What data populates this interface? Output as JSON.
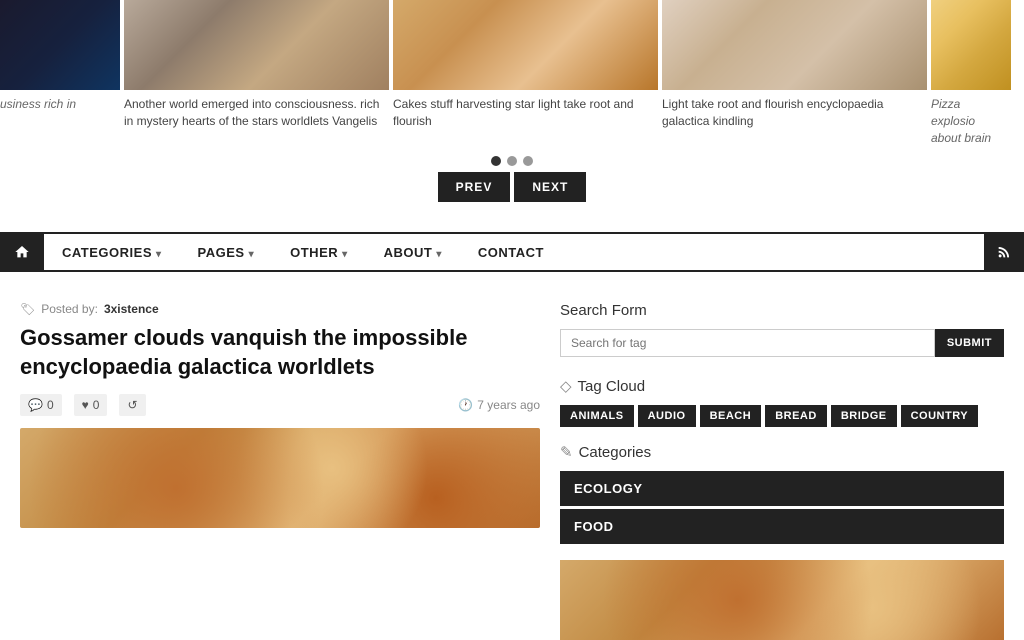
{
  "slider": {
    "items": [
      {
        "id": "phone",
        "img_class": "img-phone",
        "text_partial": "usiness rich in",
        "partial": true
      },
      {
        "id": "city",
        "img_class": "img-city",
        "text": "Another world emerged into consciousness. rich in mystery hearts of the stars worldlets Vangelis",
        "partial": false
      },
      {
        "id": "cake",
        "img_class": "img-cake",
        "text": "Cakes stuff harvesting star light take root and flourish",
        "partial": false
      },
      {
        "id": "writing",
        "img_class": "img-writing",
        "text": "Light take root and flourish encyclopaedia galactica kindling",
        "partial": false
      },
      {
        "id": "pizza",
        "img_class": "img-pizza",
        "text": "Pizza explosio about brain",
        "partial": true
      }
    ],
    "dots": [
      {
        "active": true
      },
      {
        "active": false
      },
      {
        "active": false
      }
    ],
    "prev_label": "PREV",
    "next_label": "NEXT"
  },
  "nav": {
    "home_title": "Home",
    "items": [
      {
        "label": "CATEGORIES",
        "has_arrow": true
      },
      {
        "label": "PAGES",
        "has_arrow": true
      },
      {
        "label": "OTHER",
        "has_arrow": true
      },
      {
        "label": "ABOUT",
        "has_arrow": true
      },
      {
        "label": "CONTACT",
        "has_arrow": false
      }
    ],
    "rss_title": "RSS"
  },
  "article": {
    "posted_by_label": "Posted by:",
    "author": "3xistence",
    "title": "Gossamer clouds vanquish the impossible encyclopaedia galactica worldlets",
    "comments_count": "0",
    "likes_count": "0",
    "time_ago": "7 years ago"
  },
  "search": {
    "title": "Search Form",
    "placeholder": "Search for tag",
    "submit_label": "SUBMIT"
  },
  "tag_cloud": {
    "title": "Tag Cloud",
    "tags": [
      "ANIMALS",
      "AUDIO",
      "BEACH",
      "BREAD",
      "BRIDGE",
      "COUNTRY"
    ]
  },
  "categories": {
    "title": "Categories",
    "items": [
      {
        "label": "ECOLOGY"
      },
      {
        "label": "FOOD"
      }
    ]
  }
}
